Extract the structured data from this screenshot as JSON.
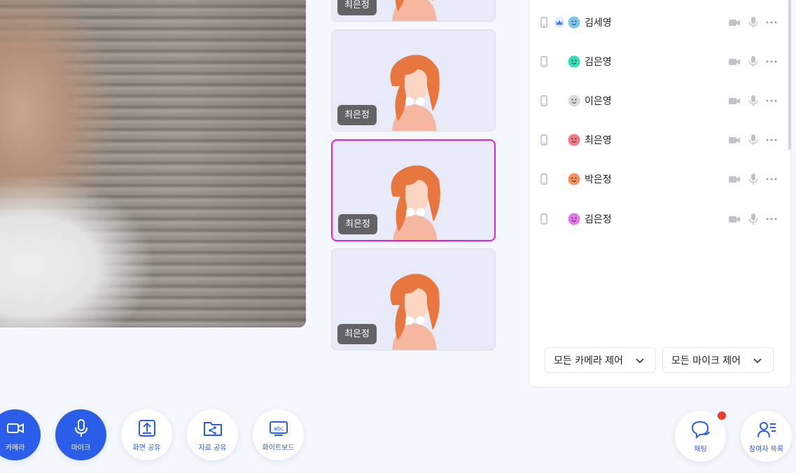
{
  "thumbnails": [
    {
      "name": "최은정",
      "active": false
    },
    {
      "name": "최은정",
      "active": false
    },
    {
      "name": "최은정",
      "active": true
    },
    {
      "name": "최은정",
      "active": false
    }
  ],
  "participants": [
    {
      "name": "김세영",
      "host": true,
      "face_color": "#7cc6f0"
    },
    {
      "name": "김은영",
      "host": false,
      "face_color": "#2ee0b4"
    },
    {
      "name": "이은영",
      "host": false,
      "face_color": "#d9d9d9"
    },
    {
      "name": "최은영",
      "host": false,
      "face_color": "#f47b84"
    },
    {
      "name": "박은정",
      "host": false,
      "face_color": "#f6905c"
    },
    {
      "name": "김은정",
      "host": false,
      "face_color": "#e877e6"
    }
  ],
  "controls": {
    "camera_all": "모든 카메라 제어",
    "mic_all": "모든 마이크 제어"
  },
  "toolbar": {
    "camera": "카메라",
    "mic": "마이크",
    "screen_share": "화면 공유",
    "file_share": "자료 공유",
    "whiteboard": "화이트보드",
    "chat": "채팅",
    "participants": "참여자 목록"
  },
  "colors": {
    "accent": "#2a5ee8",
    "active_border": "#e61ed8",
    "badge": "#ef3b2f"
  }
}
